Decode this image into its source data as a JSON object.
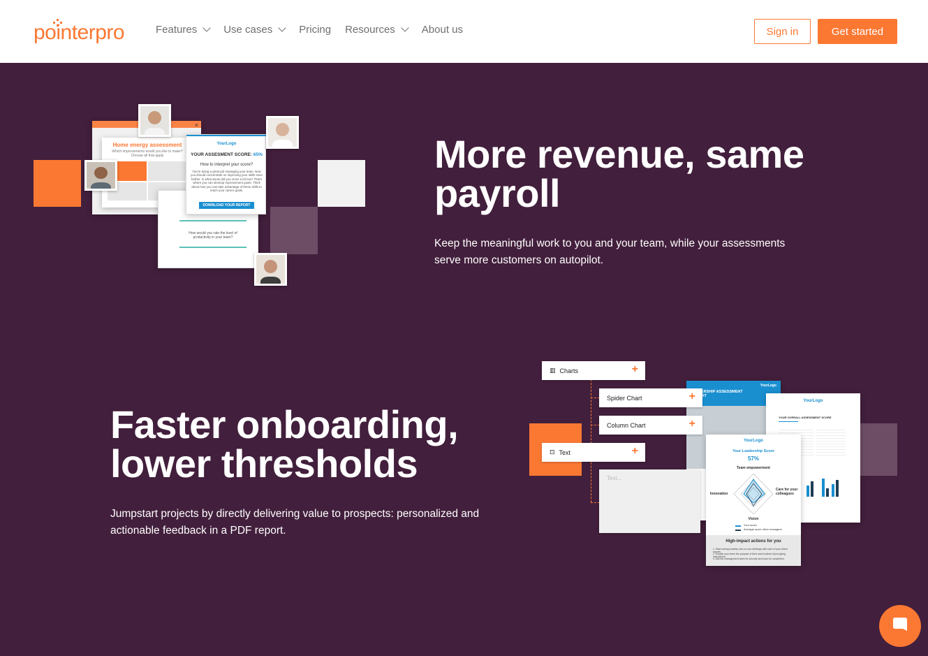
{
  "brand": {
    "name": "pointerpro",
    "accent": "#fb7833",
    "bg": "#421f3c"
  },
  "nav": {
    "items": [
      {
        "label": "Features",
        "dropdown": true
      },
      {
        "label": "Use cases",
        "dropdown": true
      },
      {
        "label": "Pricing",
        "dropdown": false
      },
      {
        "label": "Resources",
        "dropdown": true
      },
      {
        "label": "About us",
        "dropdown": false
      }
    ],
    "sign_in": "Sign in",
    "get_started": "Get started"
  },
  "section1": {
    "title_line1": "More revenue, same",
    "title_line2": "payroll",
    "text": "Keep the meaningful work to you and your team, while your assessments serve more customers on autopilot.",
    "mock": {
      "energy_title": "Home energy assessment",
      "energy_question": "Which improvements would you like to make? Choose all that apply",
      "close": "×",
      "logo": "YourLogo",
      "score_label": "YOUR ASSESMENT SCORE:",
      "score_value": "65%",
      "interpret": "How to interpret your score?",
      "interpret_text": "You're doing a great job managing your team. Now you should concentrate on improving your skills even further. In what areas did you score a bit low? That's where you can develop improvement goals. Think about how you can take advantage of these skills to reach your career goals.",
      "download": "DOWNLOAD YOUR REPORT",
      "q_productivity": "How would you rate the level of productivity in your team?"
    }
  },
  "section2": {
    "title_line1": "Faster onboarding,",
    "title_line2": "lower thresholds",
    "text": "Jumpstart projects by directly delivering value to prospects: personalized and actionable feedback in a PDF report.",
    "mock": {
      "tools": [
        "Charts",
        "Spider Chart",
        "Column Chart",
        "Text"
      ],
      "text_placeholder": "Text...",
      "report_title": "LEADERSHIP ASSESSMENT REPORT",
      "overall_title": "YOUR OVERALL ASSESSMENT SCORE",
      "logo": "YourLogo",
      "leadership_score_label": "Your Leadership Score",
      "leadership_score": "57%",
      "team_empowerment": "Team empowerment",
      "innovation": "Innovation",
      "care": "Care for your colleagues",
      "vision": "Vision",
      "legend_you": "Your score",
      "legend_avg": "Average score other managers",
      "actions_title": "High-impact actions for you",
      "actions": [
        "1. Start having monthly one-on-one meetings with each of your direct reports.",
        "2. Explain your team the purpose of their work instead of just giving instructions.",
        "3. Ask the management team for security and tools for completion."
      ]
    }
  }
}
